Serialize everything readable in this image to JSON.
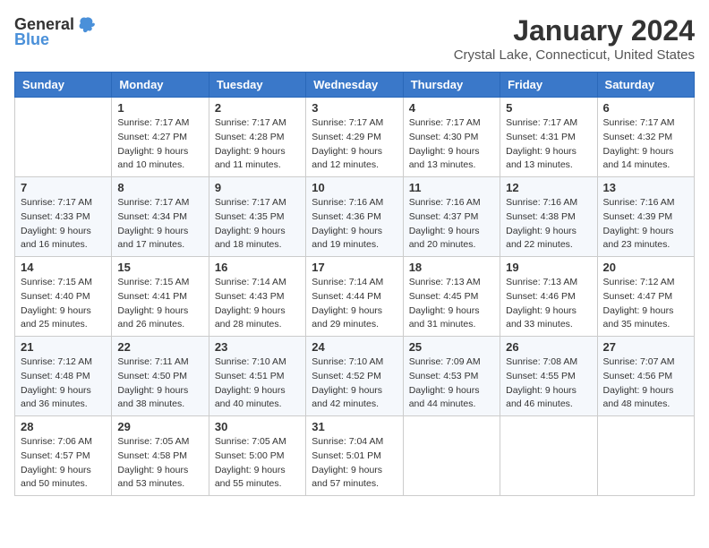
{
  "header": {
    "logo_general": "General",
    "logo_blue": "Blue",
    "title": "January 2024",
    "subtitle": "Crystal Lake, Connecticut, United States"
  },
  "days_of_week": [
    "Sunday",
    "Monday",
    "Tuesday",
    "Wednesday",
    "Thursday",
    "Friday",
    "Saturday"
  ],
  "weeks": [
    [
      {
        "day": "",
        "info": ""
      },
      {
        "day": "1",
        "info": "Sunrise: 7:17 AM\nSunset: 4:27 PM\nDaylight: 9 hours\nand 10 minutes."
      },
      {
        "day": "2",
        "info": "Sunrise: 7:17 AM\nSunset: 4:28 PM\nDaylight: 9 hours\nand 11 minutes."
      },
      {
        "day": "3",
        "info": "Sunrise: 7:17 AM\nSunset: 4:29 PM\nDaylight: 9 hours\nand 12 minutes."
      },
      {
        "day": "4",
        "info": "Sunrise: 7:17 AM\nSunset: 4:30 PM\nDaylight: 9 hours\nand 13 minutes."
      },
      {
        "day": "5",
        "info": "Sunrise: 7:17 AM\nSunset: 4:31 PM\nDaylight: 9 hours\nand 13 minutes."
      },
      {
        "day": "6",
        "info": "Sunrise: 7:17 AM\nSunset: 4:32 PM\nDaylight: 9 hours\nand 14 minutes."
      }
    ],
    [
      {
        "day": "7",
        "info": "Sunrise: 7:17 AM\nSunset: 4:33 PM\nDaylight: 9 hours\nand 16 minutes."
      },
      {
        "day": "8",
        "info": "Sunrise: 7:17 AM\nSunset: 4:34 PM\nDaylight: 9 hours\nand 17 minutes."
      },
      {
        "day": "9",
        "info": "Sunrise: 7:17 AM\nSunset: 4:35 PM\nDaylight: 9 hours\nand 18 minutes."
      },
      {
        "day": "10",
        "info": "Sunrise: 7:16 AM\nSunset: 4:36 PM\nDaylight: 9 hours\nand 19 minutes."
      },
      {
        "day": "11",
        "info": "Sunrise: 7:16 AM\nSunset: 4:37 PM\nDaylight: 9 hours\nand 20 minutes."
      },
      {
        "day": "12",
        "info": "Sunrise: 7:16 AM\nSunset: 4:38 PM\nDaylight: 9 hours\nand 22 minutes."
      },
      {
        "day": "13",
        "info": "Sunrise: 7:16 AM\nSunset: 4:39 PM\nDaylight: 9 hours\nand 23 minutes."
      }
    ],
    [
      {
        "day": "14",
        "info": "Sunrise: 7:15 AM\nSunset: 4:40 PM\nDaylight: 9 hours\nand 25 minutes."
      },
      {
        "day": "15",
        "info": "Sunrise: 7:15 AM\nSunset: 4:41 PM\nDaylight: 9 hours\nand 26 minutes."
      },
      {
        "day": "16",
        "info": "Sunrise: 7:14 AM\nSunset: 4:43 PM\nDaylight: 9 hours\nand 28 minutes."
      },
      {
        "day": "17",
        "info": "Sunrise: 7:14 AM\nSunset: 4:44 PM\nDaylight: 9 hours\nand 29 minutes."
      },
      {
        "day": "18",
        "info": "Sunrise: 7:13 AM\nSunset: 4:45 PM\nDaylight: 9 hours\nand 31 minutes."
      },
      {
        "day": "19",
        "info": "Sunrise: 7:13 AM\nSunset: 4:46 PM\nDaylight: 9 hours\nand 33 minutes."
      },
      {
        "day": "20",
        "info": "Sunrise: 7:12 AM\nSunset: 4:47 PM\nDaylight: 9 hours\nand 35 minutes."
      }
    ],
    [
      {
        "day": "21",
        "info": "Sunrise: 7:12 AM\nSunset: 4:48 PM\nDaylight: 9 hours\nand 36 minutes."
      },
      {
        "day": "22",
        "info": "Sunrise: 7:11 AM\nSunset: 4:50 PM\nDaylight: 9 hours\nand 38 minutes."
      },
      {
        "day": "23",
        "info": "Sunrise: 7:10 AM\nSunset: 4:51 PM\nDaylight: 9 hours\nand 40 minutes."
      },
      {
        "day": "24",
        "info": "Sunrise: 7:10 AM\nSunset: 4:52 PM\nDaylight: 9 hours\nand 42 minutes."
      },
      {
        "day": "25",
        "info": "Sunrise: 7:09 AM\nSunset: 4:53 PM\nDaylight: 9 hours\nand 44 minutes."
      },
      {
        "day": "26",
        "info": "Sunrise: 7:08 AM\nSunset: 4:55 PM\nDaylight: 9 hours\nand 46 minutes."
      },
      {
        "day": "27",
        "info": "Sunrise: 7:07 AM\nSunset: 4:56 PM\nDaylight: 9 hours\nand 48 minutes."
      }
    ],
    [
      {
        "day": "28",
        "info": "Sunrise: 7:06 AM\nSunset: 4:57 PM\nDaylight: 9 hours\nand 50 minutes."
      },
      {
        "day": "29",
        "info": "Sunrise: 7:05 AM\nSunset: 4:58 PM\nDaylight: 9 hours\nand 53 minutes."
      },
      {
        "day": "30",
        "info": "Sunrise: 7:05 AM\nSunset: 5:00 PM\nDaylight: 9 hours\nand 55 minutes."
      },
      {
        "day": "31",
        "info": "Sunrise: 7:04 AM\nSunset: 5:01 PM\nDaylight: 9 hours\nand 57 minutes."
      },
      {
        "day": "",
        "info": ""
      },
      {
        "day": "",
        "info": ""
      },
      {
        "day": "",
        "info": ""
      }
    ]
  ]
}
